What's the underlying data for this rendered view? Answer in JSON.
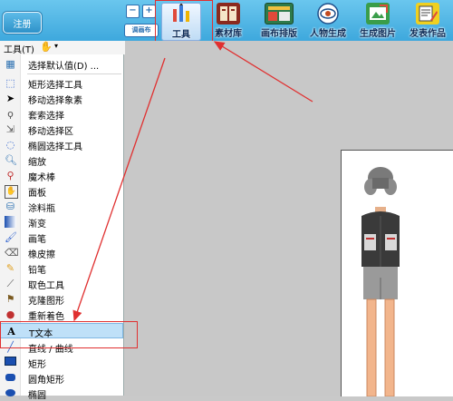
{
  "topbar": {
    "login_label": "注册",
    "canvas_label": "调画布",
    "items": [
      {
        "label": "工具",
        "icon": "tools-icon"
      },
      {
        "label": "素材库",
        "icon": "materials-icon"
      },
      {
        "label": "画布排版",
        "icon": "layout-icon"
      },
      {
        "label": "人物生成",
        "icon": "eye-icon"
      },
      {
        "label": "生成图片",
        "icon": "export-image-icon"
      },
      {
        "label": "发表作品",
        "icon": "publish-icon"
      }
    ]
  },
  "menubar": {
    "label": "工具(T)"
  },
  "menu": {
    "items": [
      {
        "label": "选择默认值(D) ...",
        "icon": "default-select-icon"
      },
      {
        "label": "矩形选择工具",
        "icon": "rect-select-icon"
      },
      {
        "label": "移动选择象素",
        "icon": "move-pixels-icon"
      },
      {
        "label": "套索选择",
        "icon": "lasso-icon"
      },
      {
        "label": "移动选择区",
        "icon": "move-selection-icon"
      },
      {
        "label": "椭圆选择工具",
        "icon": "ellipse-select-icon"
      },
      {
        "label": "缩放",
        "icon": "zoom-icon"
      },
      {
        "label": "魔术棒",
        "icon": "magic-wand-icon"
      },
      {
        "label": "面板",
        "icon": "hand-icon"
      },
      {
        "label": "涂料瓶",
        "icon": "paint-bucket-icon"
      },
      {
        "label": "渐变",
        "icon": "gradient-icon"
      },
      {
        "label": "画笔",
        "icon": "brush-icon"
      },
      {
        "label": "橡皮擦",
        "icon": "eraser-icon"
      },
      {
        "label": "铅笔",
        "icon": "pencil-icon"
      },
      {
        "label": "取色工具",
        "icon": "color-picker-icon"
      },
      {
        "label": "克隆图形",
        "icon": "clone-stamp-icon"
      },
      {
        "label": "重新着色",
        "icon": "recolor-icon"
      },
      {
        "label": "T文本",
        "icon": "text-icon"
      },
      {
        "label": "直线 / 曲线",
        "icon": "line-curve-icon"
      },
      {
        "label": "矩形",
        "icon": "rectangle-icon"
      },
      {
        "label": "圆角矩形",
        "icon": "rounded-rect-icon"
      },
      {
        "label": "椭圆",
        "icon": "ellipse-icon"
      }
    ],
    "selected_index": 17
  },
  "colors": {
    "toolbar": "#3ea8dd",
    "highlight": "#e03030",
    "menu_selected": "#bfe0f8"
  }
}
